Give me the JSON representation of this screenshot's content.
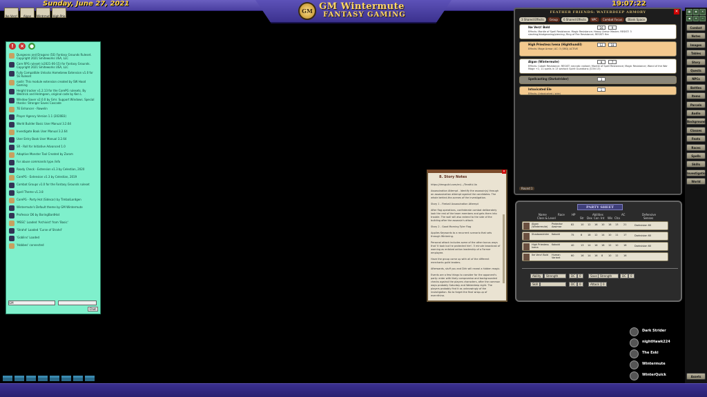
{
  "header": {
    "date": "Sunday, June 27, 2021",
    "time": "19:07:22",
    "logo_emblem": "GM",
    "logo_title": "GM Wintermute",
    "logo_subtitle": "FANTASY GAMING"
  },
  "tokens": [
    "Ike Verz!",
    "Algan Wit",
    "Wintrmut",
    "High Prie"
  ],
  "chat": {
    "entries": [
      "Dungeons and Dragons (5E) Fantasy Grounds Ruleset. Copyright 2021 Smiteworks USA, LLC",
      "Core RPG ruleset (v2021-06-15) for Fantasy Grounds. Copyright 2021 Smiteworks USA, LLC",
      "Fully Compatible Unlocks Homebrew Extension v1.0 for 5E Ruleset",
      "nadir: This module extension created by SW Hood Gaming",
      "Height tracker v1.2.13 for the CorePG rulesets. By Weldrick and Helmgeen, original code by Ken L",
      "Window Saver v2.0.0 by Gmr. Support Windows. Special thanks: Stronger Saves Cascade",
      "7E Enhancer - Rowelin",
      "Player Agency Version 1.1 (2020B3)",
      "World Builder Basic User Manual 3.2.64",
      "Investigate Book User Manual 3.2.64",
      "User Entry Book User Manual 3.2.64",
      "SR - Roll for Initiative Advanced 1.0",
      "Adaptive Monster Tool Created by Zarom",
      "For abuse commands type /info",
      "Ready Check - Extension v1.3 by Celestian, 2020",
      "CorePG - Extension v1.3 by Celestian, 2019",
      "Combat Groups v1.0 for the Fantasy Grounds ruleset",
      "Spell Theme v1.3.8",
      "CorePG - Party Hot (Sidecar) by TimbalLordgen",
      "Wintermute's Default theme by GM Wintermute",
      "Professor D6 by BoringBardHat",
      "'MSSC' Loaded 'Archivist' from 'Basic'",
      "'Strahd' Loaded 'Curse of Strahd'",
      "'Goblins' Loaded",
      "'Hobbes' connected"
    ],
    "input_value": "GM",
    "send_label": "Chat"
  },
  "combat_tracker": {
    "title": "FEATHER FRIENDS: WATERDEEP ARMORY",
    "header_pills": [
      "3 Shared Effects",
      "Group",
      "6 Shared Effects",
      "NPC",
      "Combat Focus",
      "Blank Space"
    ],
    "rows": [
      {
        "name": "Ike Verz! Bold",
        "init": "16",
        "hp": "9",
        "effect": "Effects: Mantle of Spell Resistance; Magic Resistance; Heavy Armor Master; RESIST: 3 slashing/bludgeoning/piercing; Ring of Fire Resistance; RESIST: fire",
        "style": "white"
      },
      {
        "name": "High Priestess Ivena (Highthundil)",
        "init": "12",
        "hp": "18",
        "effect": "Effects: Mage Armor; AC: 3 (SRD) ACTIVE",
        "style": "orange"
      },
      {
        "name": "Algan (Wintermute)",
        "init": "9",
        "hp": "7",
        "effect": "Effects: Cobalt Resistance; RESIST: necrotic radiant; Mantle of Spell Resistance; Magic Resistance; Wand of the War Mage +1; 11 spells in 13 warlock Spirit Guardians (CON 13)",
        "style": "white"
      },
      {
        "name": "Spellcasting (Darkstrider)",
        "init": "3",
        "hp": "",
        "effect": "Targets: Intoxicated Ele",
        "style": "grey"
      },
      {
        "name": "Intoxicated Ele",
        "init": "1",
        "hp": "",
        "effect": "Effects: (Intoxicated / side)",
        "style": "orange"
      }
    ],
    "round_label": "Round 1"
  },
  "party_sheet": {
    "title": "PARTY SHEET",
    "col_name": "Name",
    "col_class": "Class & Level",
    "col_race": "Race",
    "col_hp": "HP",
    "col_abilities": "Abilities",
    "col_ac": "AC",
    "col_defensive": "Defensive",
    "col_senses": "Senses",
    "stats_header": [
      "Str",
      "Dex",
      "Con",
      "Int",
      "Wis",
      "Cha"
    ],
    "members": [
      {
        "name": "Algan (Wintermute)",
        "class": "Cleric 10",
        "race": "Protector Aasimar",
        "hp": "82",
        "stats": [
          "10",
          "12",
          "16",
          "10",
          "18",
          "13"
        ],
        "ac": "21",
        "senses": "Darkvision 60"
      },
      {
        "name": "Shadowstrider",
        "class": "Rogue 10",
        "race": "Kobold",
        "hp": "75",
        "stats": [
          "8",
          "18",
          "12",
          "14",
          "10",
          "11"
        ],
        "ac": "17",
        "senses": "Darkvision 60"
      },
      {
        "name": "High Priestess Ivena",
        "class": "Paladin 4",
        "race": "Kobold",
        "hp": "40",
        "stats": [
          "13",
          "14",
          "16",
          "18",
          "12",
          "10"
        ],
        "ac": "18",
        "senses": "Darkvision 60"
      },
      {
        "name": "Ike Verz! Bold",
        "class": "Fighter 5 / Wizard 2",
        "race": "Human Variant",
        "hp": "60",
        "stats": [
          "16",
          "14",
          "16",
          "8",
          "10",
          "12"
        ],
        "ac": "16",
        "senses": ""
      }
    ],
    "ability_label": "Ability",
    "ability_value": "Strength",
    "save_label": "Save",
    "save_value": "Strength",
    "dc_label": "DC",
    "dc_value": "0",
    "skill_label": "Skill",
    "attack_label": "Attack"
  },
  "story": {
    "title": "8. Story Notes",
    "link": "https://dmsguild.com/en/.../Treatful.lia",
    "paragraphs": [
      "Assassination Attempt - Identify the assassin(s) through an assassination attempt against the candidates. The whole behind-the-scenes of the investigation.",
      "Story 1 - Fireball Assassination Attempt",
      "After flag operations, confederate combat deliberately look the rest of the team members and gets them into trouble. The wall will also extend to the side of the building after the assassin's attack.",
      "Story 2 - Good Morning Tyler Flag",
      "Applies Keywords to a recurrent scenario that sets through Wintering.",
      "Personal attack includes some of the other bonus ways that 'it took but he protected him'. 5 minute broadcast of warning as enlisted action leadership of a Former employee.",
      "Have the group come up with all of the different merchants guild leaders.",
      "Afterwards, stuff you and Dirk will reveal a hidden magic.",
      "Events are a few things to consider for the opponent's party: enter with likely compromise and backgrounded checks against the players characters, after the common ways probably Saturday and Waterdeep night. The players probably find it as unknowingly of the investigation. No to forget the final wrap-up of everything."
    ]
  },
  "sidebar": {
    "buttons": [
      "Combat",
      "Notes",
      "Images",
      "Tables",
      "Story",
      "Quests",
      "NPCs",
      "Battles",
      "Items",
      "Parcels",
      "Audio",
      "Backgrounds",
      "Classes",
      "Feats",
      "Races",
      "Spells",
      "Skills",
      "Investigation",
      "World Builder"
    ],
    "bottom_button": "Assets"
  },
  "users": [
    "Dark Strider",
    "nightHawk224",
    "The Eski",
    "Wintermute",
    "WinterQuick"
  ]
}
